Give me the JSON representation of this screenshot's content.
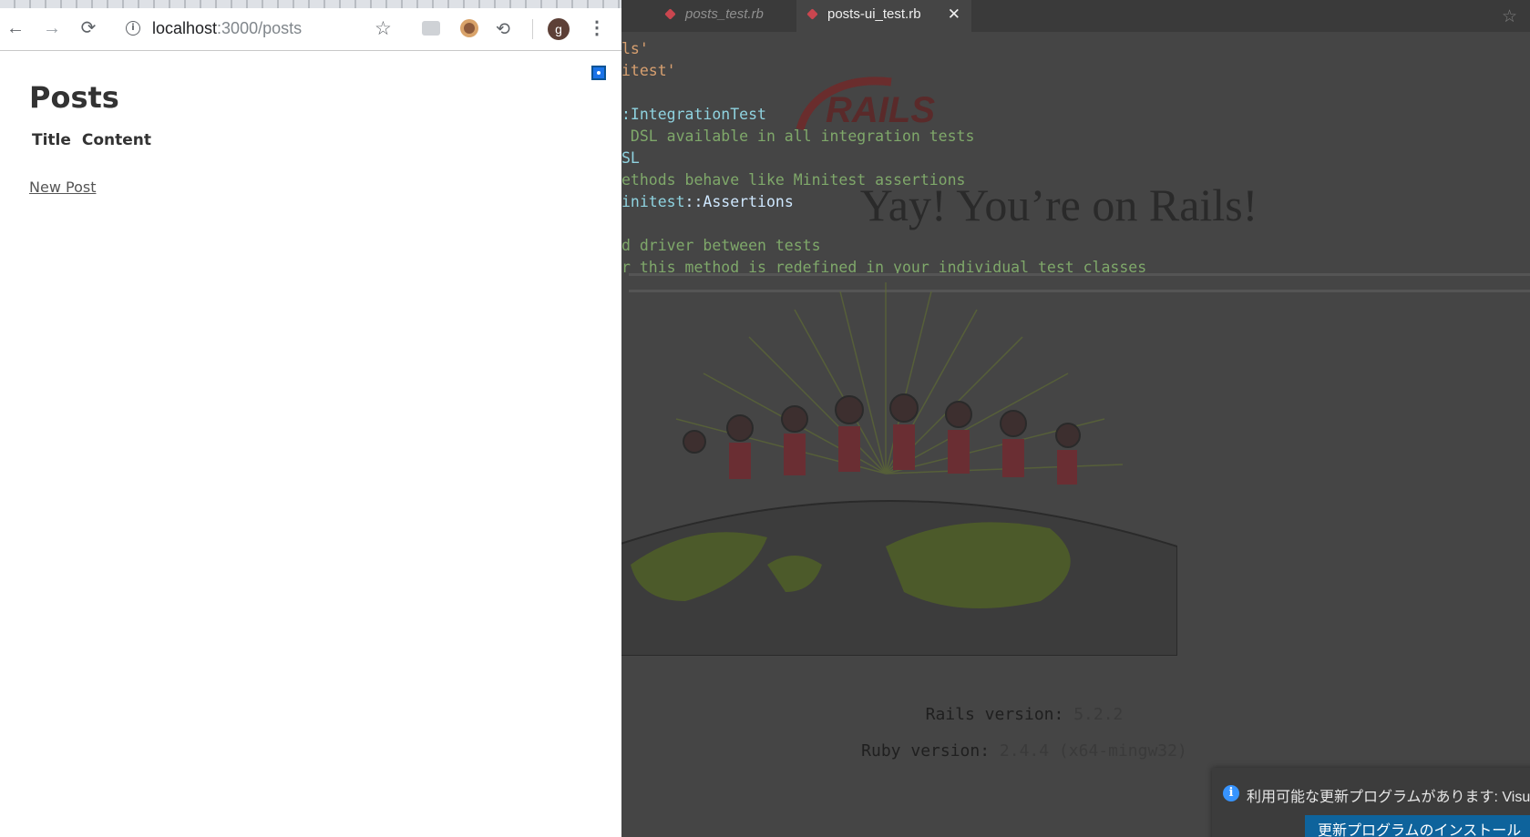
{
  "editor": {
    "tabs": [
      {
        "label": "posts_test.rb",
        "active": false
      },
      {
        "label": "posts-ui_test.rb",
        "active": true
      }
    ],
    "tab_close_glyph": "✕",
    "code_lines": [
      {
        "text": "ls'",
        "kind": "str"
      },
      {
        "text": "itest'",
        "kind": "str"
      },
      {
        "text": "",
        "kind": "blank"
      },
      {
        "text": ":IntegrationTest",
        "kind": "type"
      },
      {
        "text": " DSL available in all integration tests",
        "kind": "cmt"
      },
      {
        "text": "SL",
        "kind": "type"
      },
      {
        "text": "ethods behave like Minitest assertions",
        "kind": "cmt"
      },
      {
        "text": "initest::Assertions",
        "kind": "type"
      },
      {
        "text": "",
        "kind": "blank"
      },
      {
        "text": "d driver between tests",
        "kind": "cmt"
      },
      {
        "text": "r this method is redefined in your individual test classes",
        "kind": "cmt"
      }
    ]
  },
  "rails_page": {
    "logo_text": "RAILS",
    "headline": "Yay! You’re on Rails!",
    "rails_version_label": "Rails version:",
    "rails_version": "5.2.2",
    "ruby_version_label": "Ruby version:",
    "ruby_version": "2.4.4 (x64-mingw32)"
  },
  "notification": {
    "icon": "info-icon",
    "message": "利用可能な更新プログラムがあります: Visu",
    "button_label": "更新プログラムのインストール"
  },
  "browser": {
    "nav": {
      "back": "←",
      "forward": "→",
      "reload": "⟳"
    },
    "url_host": "localhost",
    "url_path": ":3000/posts",
    "star": "☆",
    "profile_initial": "g",
    "menu": "⋮",
    "sync_glyph": "⟲"
  },
  "page": {
    "title": "Posts",
    "columns": [
      "Title",
      "Content"
    ],
    "new_link": "New Post"
  },
  "colors": {
    "editor_bg": "#454545",
    "tabbar_bg": "#3a3a3a",
    "ruby_red": "#c9464f",
    "comment_green": "#7fa86a",
    "type_cyan": "#8fd3e0",
    "string_orange": "#d8a070",
    "button_blue": "#0e639c"
  }
}
